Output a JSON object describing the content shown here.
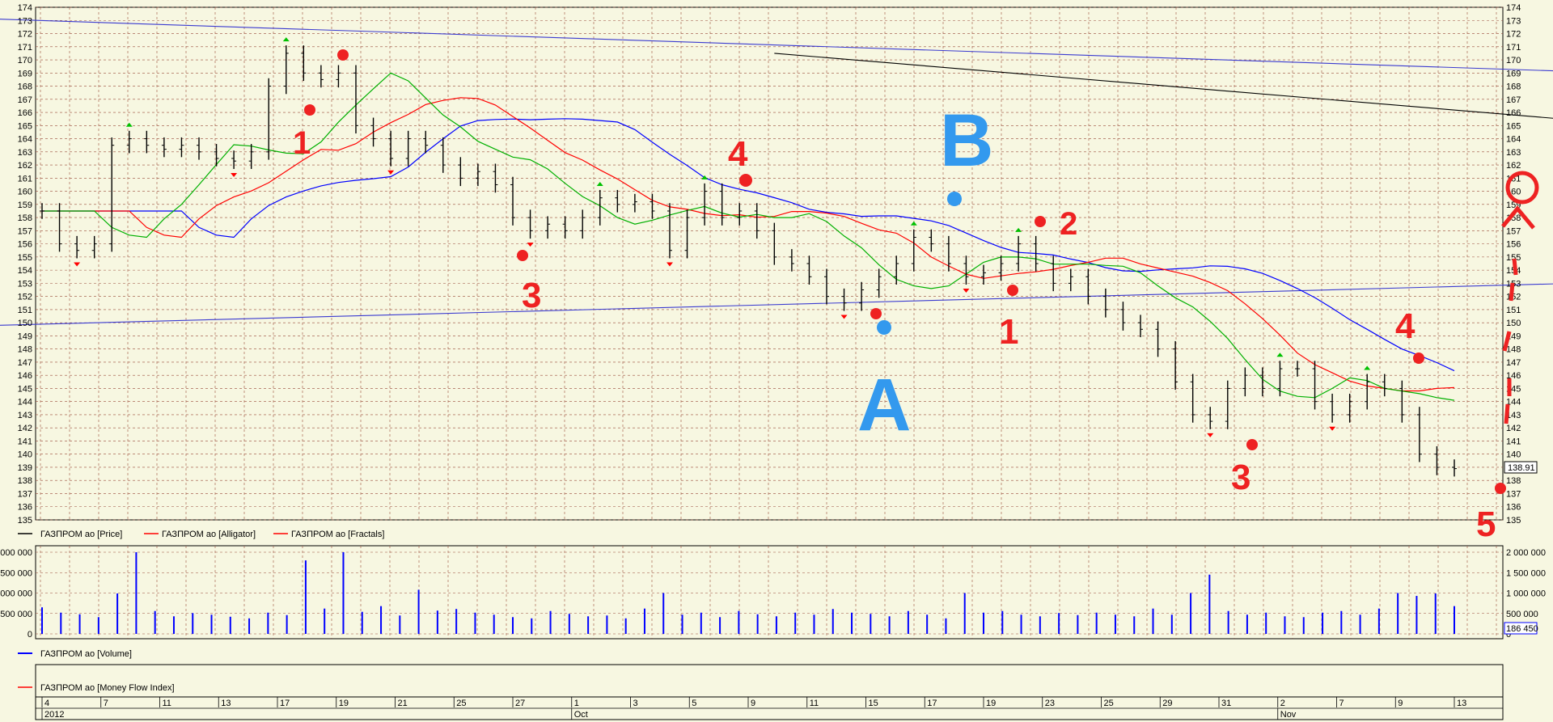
{
  "colors": {
    "background": "#f7f7e1",
    "grid": "#9a4b3a",
    "price_bars": "#000000",
    "alligator_jaw": "#0000ff",
    "alligator_teeth": "#ff0000",
    "alligator_lips": "#00b000",
    "fractal_up": "#00c000",
    "fractal_down": "#ff0000",
    "volume_bars": "#0000ff",
    "trendline_blue": "#3a3ad0",
    "trendline_black": "#000000",
    "annotation_red": "#ee2222",
    "annotation_blue": "#3399ee"
  },
  "legends": {
    "price": "ГАЗПРОМ ао [Price]",
    "alligator": "ГАЗПРОМ ао [Alligator]",
    "fractals": "ГАЗПРОМ ао [Fractals]",
    "volume": "ГАЗПРОМ ао [Volume]",
    "mfi": "ГАЗПРОМ ао [Money Flow Index]"
  },
  "price_panel": {
    "last_price_label": "138.91",
    "ticks": [
      "174",
      "173",
      "172",
      "171",
      "170",
      "169",
      "168",
      "167",
      "166",
      "165",
      "164",
      "163",
      "162",
      "161",
      "160",
      "159",
      "158",
      "157",
      "156",
      "155",
      "154",
      "153",
      "152",
      "151",
      "150",
      "149",
      "148",
      "147",
      "146",
      "145",
      "144",
      "143",
      "142",
      "141",
      "140",
      "139",
      "138",
      "137",
      "136",
      "135"
    ]
  },
  "volume_panel": {
    "last_volume_label": "186 450",
    "left_ticks": [
      "2 000 000",
      "1 500 000",
      "1 000 000",
      "500 000",
      "0"
    ],
    "right_ticks": [
      "2 000 000",
      "1 500 000",
      "1 000 000",
      "500 000",
      "0"
    ]
  },
  "time_axis": {
    "day_labels": [
      "4",
      "7",
      "11",
      "13",
      "17",
      "19",
      "21",
      "25",
      "27",
      "1",
      "3",
      "5",
      "9",
      "11",
      "15",
      "17",
      "19",
      "23",
      "25",
      "29",
      "31",
      "2",
      "7",
      "9",
      "13"
    ],
    "sub_labels": [
      "2012",
      "Oct",
      "Nov"
    ]
  },
  "annotations": {
    "red_waves_top": [
      "1",
      "3",
      "4",
      "2",
      "1"
    ],
    "red_waves_bottom": [
      "3",
      "4",
      "5"
    ],
    "blue_letters": [
      "B",
      "A"
    ]
  },
  "chart_data": {
    "type": "line",
    "title": "",
    "xlabel": "",
    "ylabel": "",
    "ylim": [
      135,
      174
    ],
    "x_ticks": [
      "4",
      "7",
      "11",
      "13",
      "17",
      "19",
      "21",
      "25",
      "27",
      "1",
      "3",
      "5",
      "9",
      "11",
      "15",
      "17",
      "19",
      "23",
      "25",
      "29",
      "31",
      "2",
      "7",
      "9",
      "13"
    ],
    "series": [
      {
        "name": "ГАЗПРОМ ао [Price]",
        "points": [
          [
            0,
            158.5
          ],
          [
            3,
            156
          ],
          [
            6,
            155.5
          ],
          [
            9,
            156
          ],
          [
            12,
            163.5
          ],
          [
            15,
            164
          ],
          [
            18,
            163.5
          ],
          [
            21,
            163.2
          ],
          [
            24,
            163.5
          ],
          [
            27,
            163
          ],
          [
            30,
            162.5
          ],
          [
            33,
            162.3
          ],
          [
            36,
            163
          ],
          [
            39,
            168
          ],
          [
            42,
            170.5
          ],
          [
            45,
            169
          ],
          [
            48,
            168.5
          ],
          [
            51,
            169
          ],
          [
            54,
            165
          ],
          [
            57,
            164
          ],
          [
            60,
            162.5
          ],
          [
            63,
            164
          ],
          [
            66,
            163.5
          ],
          [
            69,
            162
          ],
          [
            72,
            161
          ],
          [
            75,
            161.5
          ],
          [
            78,
            160.5
          ],
          [
            81,
            158
          ],
          [
            84,
            157
          ],
          [
            87,
            157.5
          ],
          [
            90,
            157
          ],
          [
            93,
            158
          ],
          [
            96,
            159.5
          ],
          [
            99,
            159
          ],
          [
            102,
            159.2
          ],
          [
            105,
            158.5
          ],
          [
            108,
            155.5
          ],
          [
            111,
            158
          ],
          [
            114,
            160
          ],
          [
            117,
            158
          ],
          [
            120,
            158.5
          ],
          [
            123,
            157
          ],
          [
            126,
            155
          ],
          [
            129,
            154.5
          ],
          [
            132,
            153.5
          ],
          [
            135,
            152
          ],
          [
            138,
            151.5
          ],
          [
            141,
            152.5
          ],
          [
            144,
            153.5
          ],
          [
            147,
            154.5
          ],
          [
            150,
            156.5
          ],
          [
            153,
            156
          ],
          [
            156,
            154.5
          ],
          [
            159,
            153.5
          ],
          [
            162,
            153.8
          ],
          [
            165,
            154.5
          ],
          [
            168,
            156
          ],
          [
            171,
            154.5
          ],
          [
            174,
            153
          ],
          [
            177,
            153.5
          ],
          [
            180,
            152
          ],
          [
            183,
            151
          ],
          [
            186,
            150
          ],
          [
            189,
            149.5
          ],
          [
            192,
            148
          ],
          [
            195,
            145.5
          ],
          [
            198,
            143
          ],
          [
            201,
            142.5
          ],
          [
            204,
            145
          ],
          [
            207,
            146
          ],
          [
            210,
            145
          ],
          [
            213,
            146.5
          ],
          [
            216,
            146.5
          ],
          [
            219,
            144
          ],
          [
            222,
            143
          ],
          [
            225,
            144
          ],
          [
            228,
            145.5
          ],
          [
            231,
            145
          ],
          [
            234,
            143
          ],
          [
            237,
            140
          ],
          [
            240,
            139
          ],
          [
            243,
            138.9
          ]
        ]
      },
      {
        "name": "ГАЗПРОМ ао [Volume]",
        "values": [
          650000,
          520000,
          480000,
          410000,
          990000,
          2000000,
          560000,
          430000,
          510000,
          470000,
          420000,
          380000,
          520000,
          460000,
          1800000,
          620000,
          2000000,
          540000,
          680000,
          450000,
          1080000,
          570000,
          610000,
          520000,
          470000,
          410000,
          380000,
          560000,
          490000,
          430000,
          450000,
          380000,
          620000,
          1000000,
          470000,
          520000,
          410000,
          560000,
          480000,
          430000,
          520000,
          470000,
          610000,
          520000,
          490000,
          430000,
          560000,
          470000,
          380000,
          1000000,
          520000,
          560000,
          470000,
          430000,
          510000,
          460000,
          520000,
          470000,
          430000,
          620000,
          470000,
          1000000,
          1450000,
          560000,
          470000,
          520000,
          430000,
          410000,
          520000,
          560000,
          470000,
          620000,
          1000000,
          930000,
          990000,
          680000
        ]
      }
    ]
  }
}
